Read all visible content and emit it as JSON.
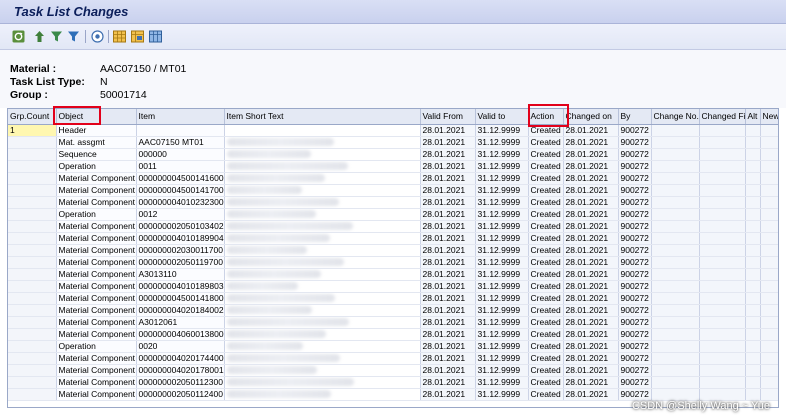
{
  "window": {
    "title": "Task List Changes"
  },
  "toolbar": {
    "icons": [
      "refresh-icon",
      "sort-ascending-icon",
      "filter-icon",
      "filter-set-icon",
      "details-icon",
      "layout-grid-icon",
      "choose-layout-icon",
      "save-layout-icon"
    ]
  },
  "header": {
    "material_label": "Material :",
    "material_value": "AAC07150 / MT01",
    "task_list_type_label": "Task List Type:",
    "task_list_type_value": "N",
    "group_label": "Group :",
    "group_value": "50001714"
  },
  "table": {
    "columns": [
      "Grp.Count",
      "Object",
      "Item",
      "Item Short Text",
      "Valid From",
      "Valid to",
      "Action",
      "Changed on",
      "By",
      "Change No.",
      "Changed Fi",
      "Alt",
      "New"
    ],
    "rows": [
      [
        "1",
        "Header",
        "",
        "",
        "28.01.2021",
        "31.12.9999",
        "Created",
        "28.01.2021",
        "900272"
      ],
      [
        "",
        "Mat. assgmt",
        "AAC07150 MT01",
        "",
        "28.01.2021",
        "31.12.9999",
        "Created",
        "28.01.2021",
        "900272"
      ],
      [
        "",
        "Sequence",
        "000000",
        "",
        "28.01.2021",
        "31.12.9999",
        "Created",
        "28.01.2021",
        "900272"
      ],
      [
        "",
        "Operation",
        "0011",
        "",
        "28.01.2021",
        "31.12.9999",
        "Created",
        "28.01.2021",
        "900272"
      ],
      [
        "",
        "Material Component",
        "000000004500141600",
        "",
        "28.01.2021",
        "31.12.9999",
        "Created",
        "28.01.2021",
        "900272"
      ],
      [
        "",
        "Material Component",
        "000000004500141700",
        "",
        "28.01.2021",
        "31.12.9999",
        "Created",
        "28.01.2021",
        "900272"
      ],
      [
        "",
        "Material Component",
        "000000004010232300",
        "",
        "28.01.2021",
        "31.12.9999",
        "Created",
        "28.01.2021",
        "900272"
      ],
      [
        "",
        "Operation",
        "0012",
        "",
        "28.01.2021",
        "31.12.9999",
        "Created",
        "28.01.2021",
        "900272"
      ],
      [
        "",
        "Material Component",
        "000000002050103402",
        "",
        "28.01.2021",
        "31.12.9999",
        "Created",
        "28.01.2021",
        "900272"
      ],
      [
        "",
        "Material Component",
        "000000004010189904",
        "",
        "28.01.2021",
        "31.12.9999",
        "Created",
        "28.01.2021",
        "900272"
      ],
      [
        "",
        "Material Component",
        "000000002030011700",
        "",
        "28.01.2021",
        "31.12.9999",
        "Created",
        "28.01.2021",
        "900272"
      ],
      [
        "",
        "Material Component",
        "000000002050119700",
        "",
        "28.01.2021",
        "31.12.9999",
        "Created",
        "28.01.2021",
        "900272"
      ],
      [
        "",
        "Material Component",
        "A3013110",
        "",
        "28.01.2021",
        "31.12.9999",
        "Created",
        "28.01.2021",
        "900272"
      ],
      [
        "",
        "Material Component",
        "000000004010189803",
        "",
        "28.01.2021",
        "31.12.9999",
        "Created",
        "28.01.2021",
        "900272"
      ],
      [
        "",
        "Material Component",
        "000000004500141800",
        "",
        "28.01.2021",
        "31.12.9999",
        "Created",
        "28.01.2021",
        "900272"
      ],
      [
        "",
        "Material Component",
        "000000004020184002",
        "",
        "28.01.2021",
        "31.12.9999",
        "Created",
        "28.01.2021",
        "900272"
      ],
      [
        "",
        "Material Component",
        "A3012061",
        "",
        "28.01.2021",
        "31.12.9999",
        "Created",
        "28.01.2021",
        "900272"
      ],
      [
        "",
        "Material Component",
        "000000004060013800",
        "",
        "28.01.2021",
        "31.12.9999",
        "Created",
        "28.01.2021",
        "900272"
      ],
      [
        "",
        "Operation",
        "0020",
        "",
        "28.01.2021",
        "31.12.9999",
        "Created",
        "28.01.2021",
        "900272"
      ],
      [
        "",
        "Material Component",
        "000000004020174400",
        "",
        "28.01.2021",
        "31.12.9999",
        "Created",
        "28.01.2021",
        "900272"
      ],
      [
        "",
        "Material Component",
        "000000004020178001",
        "",
        "28.01.2021",
        "31.12.9999",
        "Created",
        "28.01.2021",
        "900272"
      ],
      [
        "",
        "Material Component",
        "000000002050112300",
        "",
        "28.01.2021",
        "31.12.9999",
        "Created",
        "28.01.2021",
        "900272"
      ],
      [
        "",
        "Material Component",
        "000000002050112400",
        "",
        "28.01.2021",
        "31.12.9999",
        "Created",
        "28.01.2021",
        "900272"
      ]
    ]
  },
  "watermark": "CSDN @Shelly Wang ~ Yue",
  "colors": {
    "title_bar": "#c9d1ee",
    "title_text": "#0b1e5a",
    "highlight_box": "#e2001a",
    "selected_cell": "#fff7b0"
  }
}
